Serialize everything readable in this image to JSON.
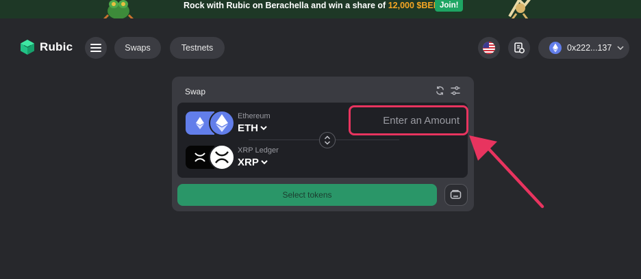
{
  "banner": {
    "text": "Rock with Rubic on Berachella and win a share of ",
    "amount": "12,000 $BERA!",
    "join_label": "Join!"
  },
  "header": {
    "logo_text": "Rubic",
    "nav": {
      "swaps_label": "Swaps",
      "testnets_label": "Testnets"
    },
    "wallet": {
      "address": "0x222...137",
      "network_icon": "ethereum-icon"
    },
    "language_icon": "us-flag-icon",
    "history_icon": "receipt-icon"
  },
  "swap_card": {
    "title": "Swap",
    "from": {
      "chain": "Ethereum",
      "symbol": "ETH",
      "icon": "ethereum-icon"
    },
    "to": {
      "chain": "XRP Ledger",
      "symbol": "XRP",
      "icon": "xrp-icon"
    },
    "amount_placeholder": "Enter an Amount",
    "select_tokens_label": "Select tokens"
  },
  "colors": {
    "background": "#27282c",
    "card": "#3a3b41",
    "accent_green": "#2a9668",
    "highlight": "#e8345f",
    "eth_purple": "#627eea"
  }
}
